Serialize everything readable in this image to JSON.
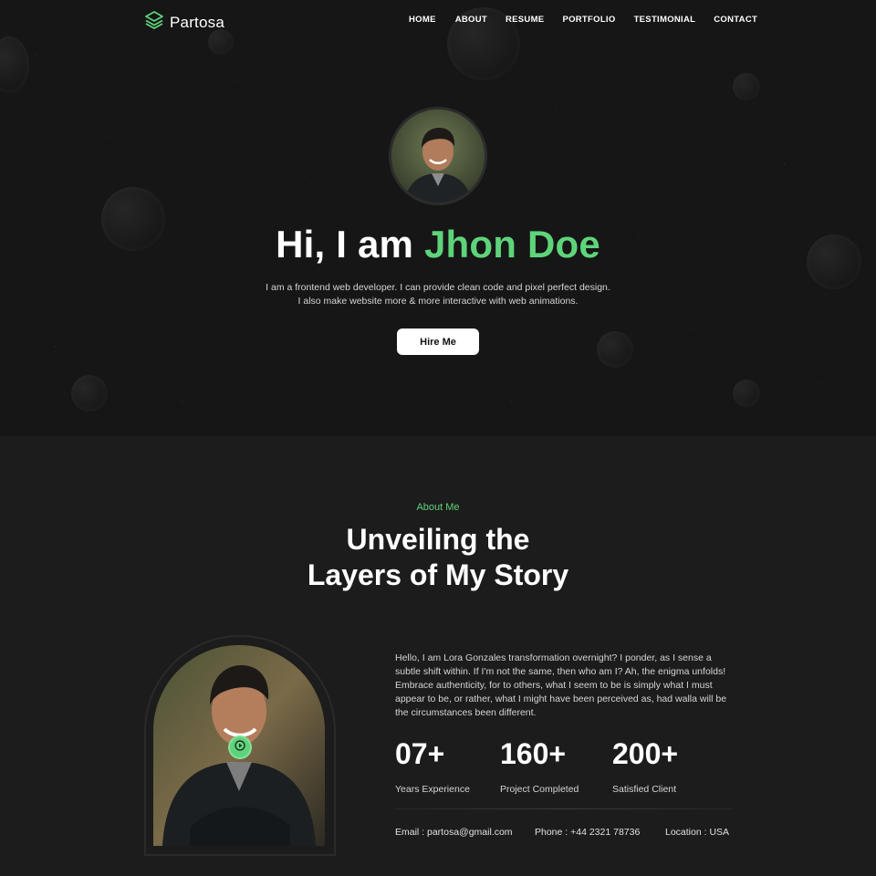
{
  "colors": {
    "accent": "#5ed47a",
    "background": "#1b1b1b",
    "text": "#ffffff"
  },
  "nav": {
    "brand": "Partosa",
    "brand_icon": "layers-icon",
    "items": [
      "HOME",
      "ABOUT",
      "RESUME",
      "PORTFOLIO",
      "TESTIMONIAL",
      "CONTACT"
    ]
  },
  "hero": {
    "title_prefix": "Hi, I am ",
    "title_name": "Jhon Doe",
    "description_line1": "I am a frontend web developer. I can provide clean code and pixel perfect design.",
    "description_line2": "I also make website more & more interactive with web animations.",
    "cta": "Hire Me"
  },
  "about": {
    "kicker": "About Me",
    "title_line1": "Unveiling the",
    "title_line2": "Layers of My Story",
    "bio": "Hello, I am Lora Gonzales transformation overnight? I ponder, as I sense a subtle shift within. If I'm not the same, then who am I? Ah, the enigma unfolds! Embrace authenticity, for to others, what I seem to be is simply what I must appear to be, or rather, what I might have been perceived as, had walla will be the circumstances been different.",
    "stats": [
      {
        "value": "07+",
        "label": "Years Experience"
      },
      {
        "value": "160+",
        "label": "Project Completed"
      },
      {
        "value": "200+",
        "label": "Satisfied Client"
      }
    ],
    "contact": {
      "email": "Email : partosa@gmail.com",
      "phone": "Phone : +44 2321 78736",
      "location": "Location : USA"
    }
  }
}
